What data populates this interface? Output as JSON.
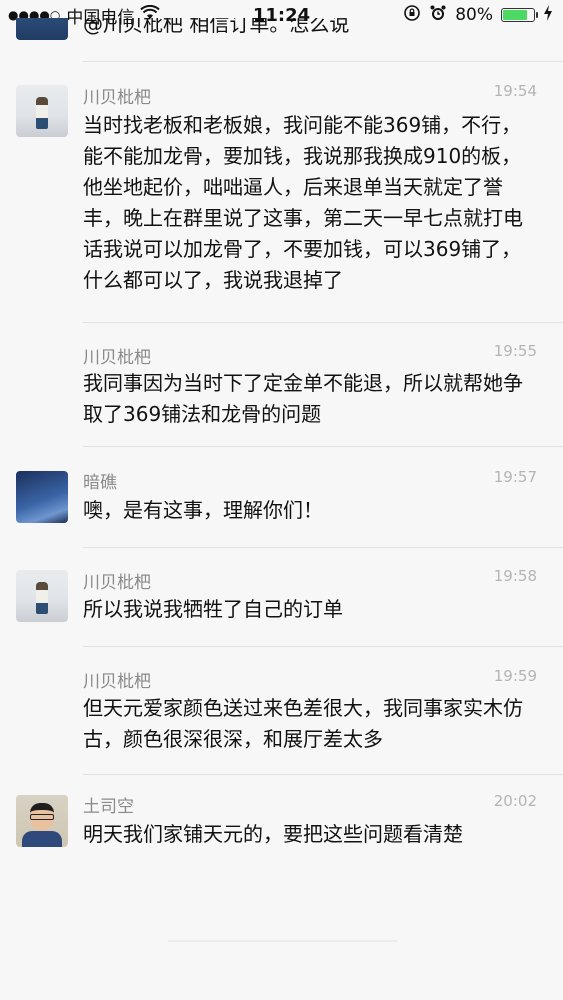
{
  "status_bar": {
    "signal": "●●●●○",
    "carrier": "中国电信",
    "wifi_icon": "wifi-icon",
    "time": "11:24",
    "battery_percent": "80%",
    "battery_level": 0.8,
    "battery_color": "#4cd964",
    "icons": [
      "orientation-lock-icon",
      "alarm-icon",
      "charging-icon"
    ]
  },
  "cut_message": {
    "text": "@川贝枇杷 相信订单。怎么说"
  },
  "messages": [
    {
      "sender": "川贝枇杷",
      "time": "19:54",
      "show_avatar": true,
      "avatar": "girl-photo",
      "text": "当时找老板和老板娘，我问能不能369铺，不行，能不能加龙骨，要加钱，我说那我换成910的板，他坐地起价，咄咄逼人，后来退单当天就定了誉丰，晚上在群里说了这事，第二天一早七点就打电话我说可以加龙骨了，不要加钱，可以369铺了，什么都可以了，我说我退掉了"
    },
    {
      "sender": "川贝枇杷",
      "time": "19:55",
      "show_avatar": false,
      "text": "我同事因为当时下了定金单不能退，所以就帮她争取了369铺法和龙骨的问题"
    },
    {
      "sender": "暗礁",
      "time": "19:57",
      "show_avatar": true,
      "avatar": "sky-photo",
      "text": "噢，是有这事，理解你们！"
    },
    {
      "sender": "川贝枇杷",
      "time": "19:58",
      "show_avatar": true,
      "avatar": "girl-photo",
      "text": "所以我说我牺牲了自己的订单"
    },
    {
      "sender": "川贝枇杷",
      "time": "19:59",
      "show_avatar": false,
      "text": "但天元爱家颜色送过来色差很大，我同事家实木仿古，颜色很深很深，和展厅差太多"
    },
    {
      "sender": "土司空",
      "time": "20:02",
      "show_avatar": true,
      "avatar": "man-photo",
      "text": "明天我们家铺天元的，要把这些问题看清楚"
    }
  ]
}
